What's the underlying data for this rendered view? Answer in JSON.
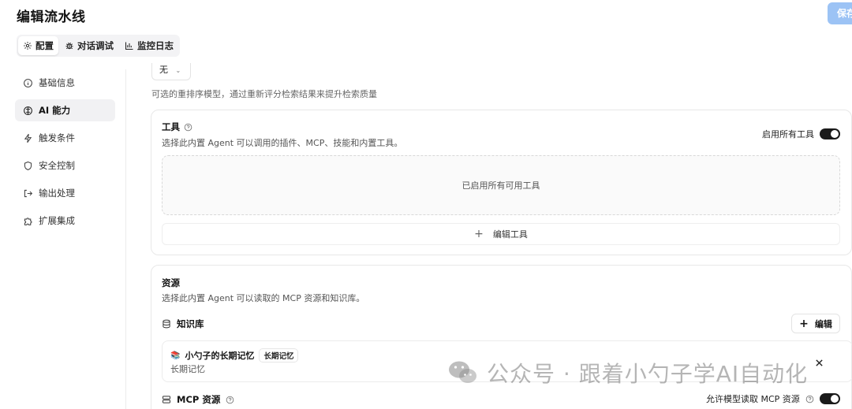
{
  "header": {
    "title": "编辑流水线",
    "save_label": "保存"
  },
  "tabs": [
    {
      "label": "配置",
      "icon": "gear-icon",
      "active": true
    },
    {
      "label": "对话调试",
      "icon": "bug-icon",
      "active": false
    },
    {
      "label": "监控日志",
      "icon": "bar-chart-icon",
      "active": false
    }
  ],
  "sidebar": {
    "items": [
      {
        "label": "基础信息",
        "icon": "info-icon",
        "active": false
      },
      {
        "label": "AI 能力",
        "icon": "brain-icon",
        "active": true
      },
      {
        "label": "触发条件",
        "icon": "lightning-icon",
        "active": false
      },
      {
        "label": "安全控制",
        "icon": "shield-icon",
        "active": false
      },
      {
        "label": "输出处理",
        "icon": "output-icon",
        "active": false
      },
      {
        "label": "扩展集成",
        "icon": "puzzle-icon",
        "active": false
      }
    ]
  },
  "rerank": {
    "value": "无",
    "description": "可选的重排序模型，通过重新评分检索结果来提升检索质量"
  },
  "tools": {
    "title": "工具",
    "description": "选择此内置 Agent 可以调用的插件、MCP、技能和内置工具。",
    "toggle_label": "启用所有工具",
    "toggle_on": true,
    "empty_state": "已启用所有可用工具",
    "edit_label": "编辑工具"
  },
  "resources": {
    "title": "资源",
    "description": "选择此内置 Agent 可以读取的 MCP 资源和知识库。",
    "knowledge_base": {
      "label": "知识库",
      "edit_label": "编辑",
      "items": [
        {
          "name": "小勺子的长期记忆",
          "badge": "长期记忆",
          "subtitle": "长期记忆"
        }
      ]
    },
    "mcp": {
      "label": "MCP 资源",
      "toggle_label": "允许模型读取 MCP 资源",
      "toggle_on": true
    }
  },
  "watermark": {
    "text": "公众号 · 跟着小勺子学AI自动化"
  }
}
